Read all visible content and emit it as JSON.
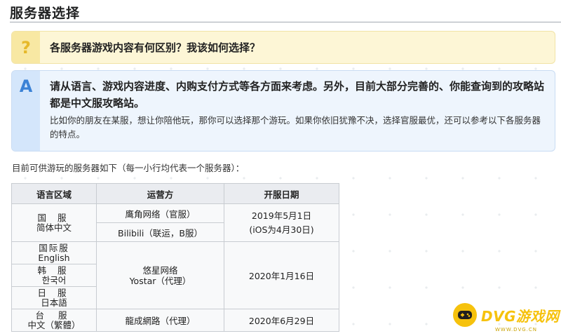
{
  "page": {
    "title": "服务器选择"
  },
  "question": {
    "icon": "?",
    "text": "各服务器游戏内容有何区别？我该如何选择？"
  },
  "answer": {
    "icon": "A",
    "main": "请从语言、游戏内容进度、内购支付方式等各方面来考虑。另外，目前大部分完善的、你能查询到的攻略站都是中文服攻略站。",
    "sub": "比如你的朋友在某服，想让你陪他玩，那你可以选择那个游玩。如果你依旧犹豫不决，选择官服最优，还可以参考以下各服务器的特点。"
  },
  "intro": "目前可供游玩的服务器如下（每一小行均代表一个服务器）：",
  "table": {
    "headers": [
      "语言区域",
      "运营方",
      "开服日期"
    ],
    "cn": {
      "label": "国 服",
      "name": "简体中文",
      "op_official": "鹰角网络（官服）",
      "op_bili": "Bilibili（联运，B服）",
      "date_line1": "2019年5月1日",
      "date_line2": "(iOS为4月30日)"
    },
    "global": {
      "label": "国际服",
      "name": "English"
    },
    "kr": {
      "label": "韩 服",
      "name": "한국어"
    },
    "jp": {
      "label": "日 服",
      "name": "日本語"
    },
    "yostar": {
      "op_line1": "悠星网络",
      "op_line2": "Yostar（代理）",
      "date": "2020年1月16日"
    },
    "tw": {
      "label": "台 服",
      "name": "中文（繁體）",
      "op": "龍成網路（代理）",
      "date": "2020年6月29日"
    }
  },
  "watermark": {
    "text": "DVG游戏网",
    "url": "WWW.DVG.CN",
    "color": "#f6c20d"
  }
}
